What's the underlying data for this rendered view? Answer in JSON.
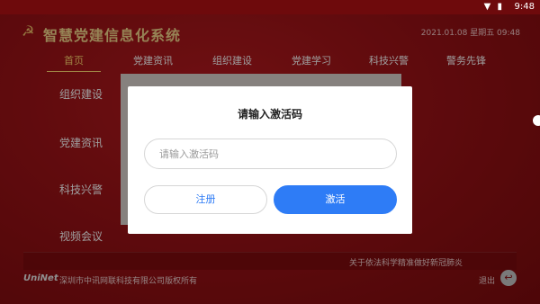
{
  "status_bar": {
    "time": "9:48",
    "icons": "▼ ▮"
  },
  "app": {
    "logo_icon": "☭",
    "title": "智慧党建信息化系统",
    "datetime": "2021.01.08 星期五 09:48"
  },
  "top_nav": [
    {
      "label": "首页",
      "active": true
    },
    {
      "label": "党建资讯"
    },
    {
      "label": "组织建设"
    },
    {
      "label": "党建学习"
    },
    {
      "label": "科技兴警"
    },
    {
      "label": "警务先锋"
    }
  ],
  "side_nav": [
    {
      "label": "组织建设"
    },
    {
      "label": "党建资讯"
    },
    {
      "label": "科技兴警"
    },
    {
      "label": "视频会议"
    }
  ],
  "footer": {
    "ticker": "关于依法科学精准做好新冠肺炎",
    "brand": "UniNet",
    "copyright": "深圳市中讯网联科技有限公司版权所有",
    "exit_label": "退出",
    "exit_icon": "↩"
  },
  "dialog": {
    "title": "请输入激活码",
    "input_placeholder": "请输入激活码",
    "input_value": "",
    "register_label": "注册",
    "activate_label": "激活"
  },
  "colors": {
    "primary_red": "#9a1216",
    "gold": "#f2d38a",
    "accent_blue": "#2e7cf6"
  }
}
